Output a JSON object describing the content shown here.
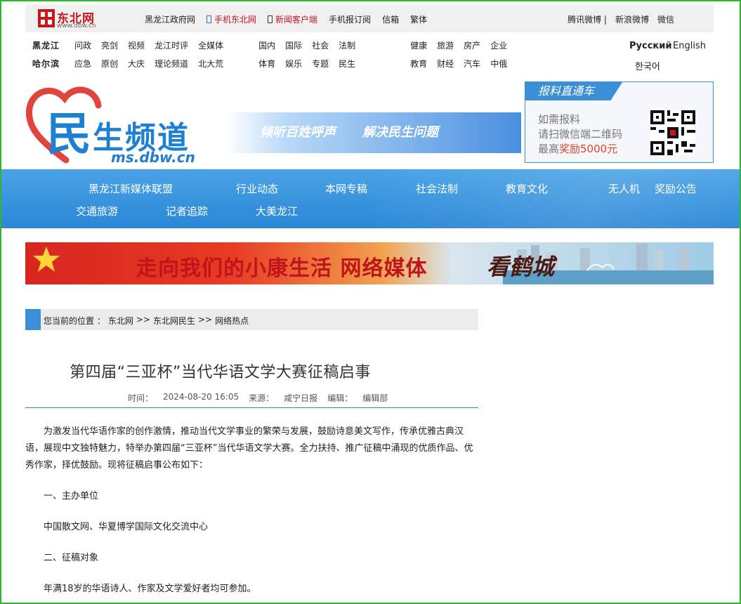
{
  "topbar": {
    "logo_text": "东北网",
    "logo_sub": "www.dbw.cn",
    "links": [
      "黑龙江政府网",
      "手机东北网",
      "新闻客户端",
      "手机报订阅",
      "信箱",
      "繁体"
    ],
    "right_links": [
      "腾讯微博 |",
      "新浪微博",
      "微信"
    ]
  },
  "nav": {
    "row1_city": "黑龙江",
    "row1_a": [
      "问政",
      "亮剑",
      "视频",
      "龙江时评",
      "全媒体"
    ],
    "row1_b": [
      "国内",
      "国际",
      "社会",
      "法制"
    ],
    "row1_c": [
      "健康",
      "旅游",
      "房产",
      "企业"
    ],
    "row2_city": "哈尔滨",
    "row2_a": [
      "应急",
      "原创",
      "大庆",
      "理论频道",
      "北大荒"
    ],
    "row2_b": [
      "体育",
      "娱乐",
      "专题",
      "民生"
    ],
    "row2_c": [
      "教育",
      "财经",
      "汽车",
      "中俄"
    ],
    "lang_ru": "Русский",
    "lang_en": "English",
    "lang_ko": "한국어"
  },
  "banner": {
    "title_a": "民",
    "title_b": "生频道",
    "url": "ms.dbw.cn",
    "slogan1": "倾听百姓呼声",
    "slogan2": "解决民生问题",
    "report_head": "报料直通车",
    "report_line1": "如需报料",
    "report_line2": "请扫微信端二维码",
    "report_line3a": "最高",
    "report_line3b": "奖励5000元"
  },
  "menu": {
    "items": [
      "黑龙江新媒体联盟",
      "行业动态",
      "本网专稿",
      "社会法制",
      "教育文化",
      "无人机",
      "奖励公告",
      "交通旅游",
      "记者追踪",
      "大美龙江"
    ]
  },
  "promo": {
    "text": "走向我们的小康生活 网络媒体",
    "calligraphy": "看鹤城"
  },
  "breadcrumb": {
    "label": "您当前的位置 ：",
    "path": [
      "东北网",
      ">>",
      "东北网民生",
      ">>",
      "网络热点"
    ]
  },
  "article": {
    "title": "第四届“三亚杯”当代华语文学大赛征稿启事",
    "time_label": "时间：",
    "time": "2024-08-20 16:05",
    "source_label": "来源：",
    "source": "咸宁日报",
    "editor_label": "编辑：",
    "editor": "编辑部",
    "p1": "为激发当代华语作家的创作激情，推动当代文学事业的繁荣与发展，鼓励诗意美文写作，传承优雅古典汉语，展现中文独特魅力，特举办第四届“三亚杯”当代华语文学大赛。全力扶持、推广征稿中涌现的优质作品、优秀作家，择优鼓励。现将征稿启事公布如下：",
    "h1": "一、主办单位",
    "p2": "中国散文网、华夏博学国际文化交流中心",
    "h2": "二、征稿对象",
    "p3": "年满18岁的华语诗人、作家及文学爱好者均可参加。"
  }
}
